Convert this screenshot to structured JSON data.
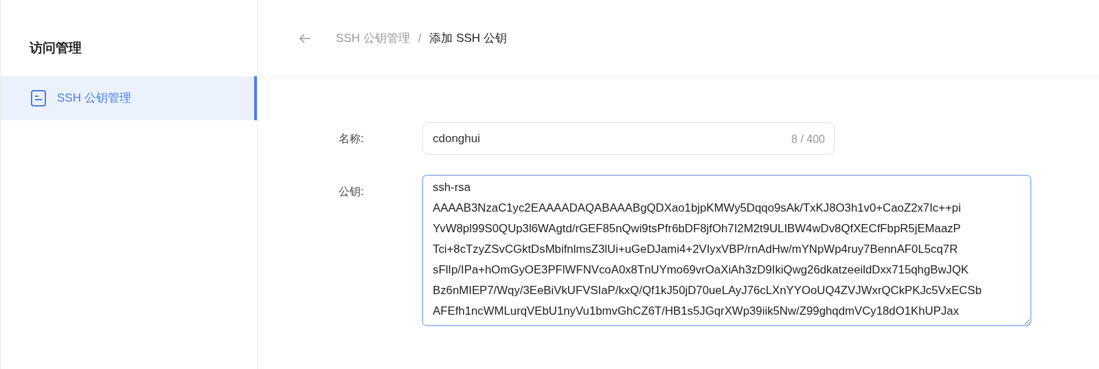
{
  "sidebar": {
    "title": "访问管理",
    "items": [
      {
        "label": "SSH 公钥管理",
        "selected": true
      }
    ]
  },
  "breadcrumb": {
    "items": [
      {
        "label": "SSH 公钥管理",
        "current": false
      },
      {
        "label": "添加 SSH 公钥",
        "current": true
      }
    ],
    "separator": "/"
  },
  "form": {
    "fields": [
      {
        "kind": "input",
        "label": "名称:",
        "value": "cdonghui",
        "counter": "8 / 400"
      },
      {
        "kind": "textarea",
        "label": "公钥:",
        "focused": true,
        "value_lines": [
          "ssh-rsa",
          "AAAAB3NzaC1yc2EAAAADAQABAAABgQDXao1bjpKMWy5Dqqo9sAk/TxKJ8O3h1v0+CaoZ2x7Ic++pi",
          "YvW8pl99S0QUp3l6WAgtd/rGEF85nQwi9tsPfr6bDF8jfOh7I2M2t9ULIBW4wDv8QfXECfFbpR5jEMaazP",
          "Tci+8cTzyZSvCGktDsMbifnlmsZ3lUi+uGeDJami4+2VIyxVBP/rnAdHw/mYNpWp4ruy7BennAF0L5cq7R",
          "sFlIp/IPa+hOmGyOE3PFlWFNVcoA0x8TnUYmo69vrOaXiAh3zD9IkiQwg26dkatzeeildDxx715qhgBwJQK",
          "Bz6nMIEP7/Wqy/3EeBiVkUFVSIaP/kxQ/Qf1kJ50jD70ueLAyJ76cLXnYYOoUQ4ZVJWxrQCkPKJc5VxECSb",
          "AFEfh1ncWMLurqVEbU1nyVu1bmvGhCZ6T/HB1s5JGqrXWp39iik5Nw/Z99ghqdmVCy18dO1KhUPJax"
        ]
      }
    ]
  }
}
